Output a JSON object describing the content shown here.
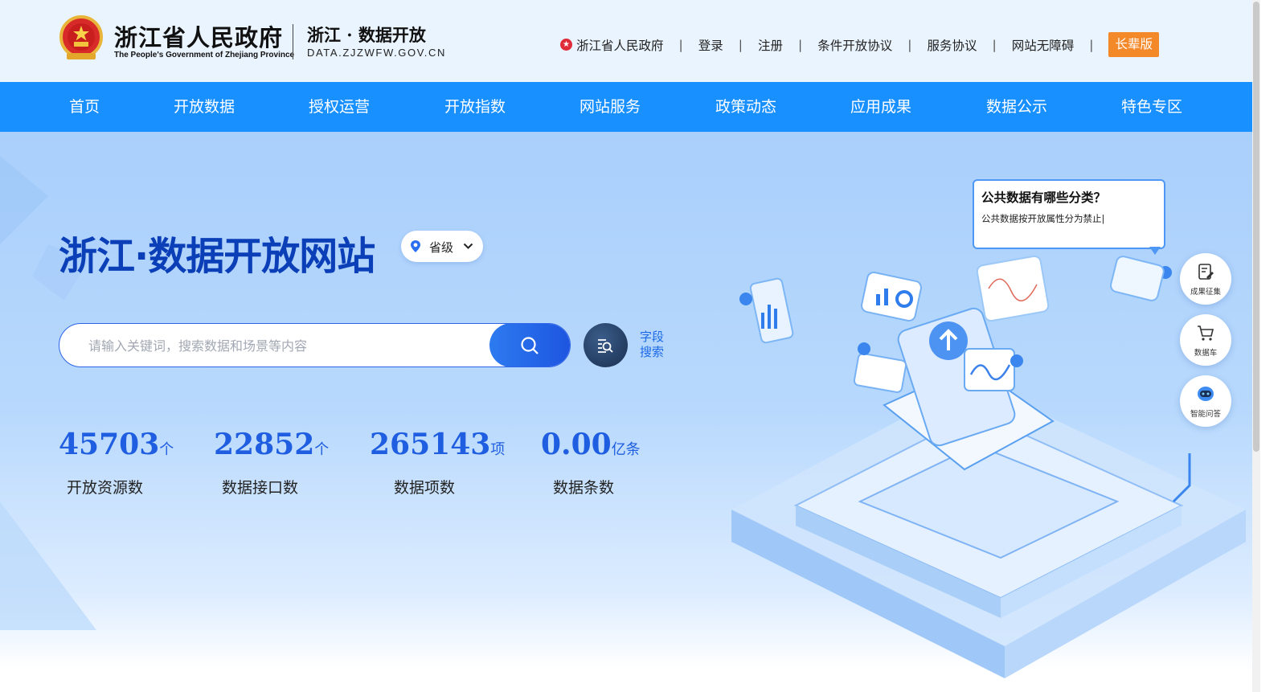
{
  "header": {
    "gov_name_cn": "浙江省人民政府",
    "gov_name_en": "The People's Government of Zhejiang Province",
    "site_name_cn": "浙江 · 数据开放",
    "site_domain": "DATA.ZJZWFW.GOV.CN",
    "links": [
      {
        "label": "浙江省人民政府",
        "icon": "star-badge-icon"
      },
      {
        "label": "登录"
      },
      {
        "label": "注册"
      },
      {
        "label": "条件开放协议"
      },
      {
        "label": "服务协议"
      },
      {
        "label": "网站无障碍"
      }
    ],
    "separator": "|",
    "elder_mode_label": "长辈版",
    "elder_color": "#f4892a"
  },
  "nav": {
    "items": [
      "首页",
      "开放数据",
      "授权运营",
      "开放指数",
      "网站服务",
      "政策动态",
      "应用成果",
      "数据公示",
      "特色专区"
    ],
    "bg_color": "#1890ff"
  },
  "hero": {
    "title": "浙江·数据开放网站",
    "region": {
      "label": "省级",
      "icon": "location-pin-icon"
    },
    "search": {
      "placeholder": "请输入关键词，搜索数据和场景等内容"
    },
    "field_search_label": "字段搜索",
    "stats": [
      {
        "value": "45703",
        "unit": "个",
        "label": "开放资源数"
      },
      {
        "value": "22852",
        "unit": "个",
        "label": "数据接口数"
      },
      {
        "value": "265143",
        "unit": "项",
        "label": "数据项数"
      },
      {
        "value": "0.00",
        "unit": "亿条",
        "label": "数据条数"
      }
    ],
    "accent_color": "#1f5ee0"
  },
  "assistant": {
    "title": "公共数据有哪些分类？",
    "text": "公共数据按开放属性分为禁止|"
  },
  "float_tools": [
    {
      "label": "成果征集",
      "icon": "edit-document-icon"
    },
    {
      "label": "数据车",
      "icon": "cart-icon"
    },
    {
      "label": "智能问答",
      "icon": "robot-icon"
    }
  ]
}
